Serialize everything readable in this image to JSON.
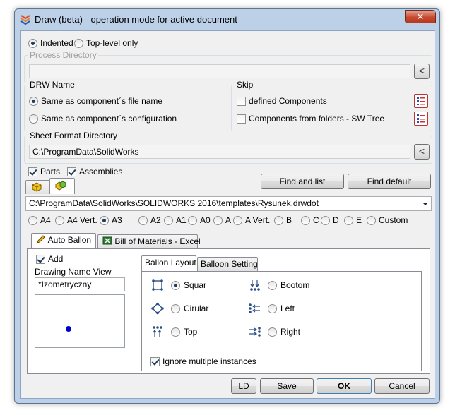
{
  "window": {
    "title": "Draw (beta) - operation mode for active document",
    "close_label": "✕"
  },
  "mode": {
    "indented": "Indented",
    "top_level": "Top-level only"
  },
  "process_directory": {
    "label": "Process Directory",
    "value": "",
    "browse": "<"
  },
  "drw_name": {
    "label": "DRW Name",
    "option_file": "Same as component´s file name",
    "option_config": "Same as component´s configuration"
  },
  "skip": {
    "label": "Skip",
    "defined": "defined Components",
    "folders": "Components from folders - SW Tree"
  },
  "sheet_format": {
    "label": "Sheet Format Directory",
    "value": "C:\\ProgramData\\SolidWorks",
    "browse": "<"
  },
  "filters": {
    "parts": "Parts",
    "assemblies": "Assemblies"
  },
  "buttons": {
    "find_and_list": "Find and list",
    "find_default": "Find default",
    "ld": "LD",
    "save": "Save",
    "ok": "OK",
    "cancel": "Cancel"
  },
  "template_path": "C:\\ProgramData\\SolidWorks\\SOLIDWORKS 2016\\templates\\Rysunek.drwdot",
  "sheet_sizes": [
    "A4",
    "A4 Vert.",
    "A3",
    "A2",
    "A1",
    "A0",
    "A",
    "A Vert.",
    "B",
    "C",
    "D",
    "E",
    "Custom"
  ],
  "selected_sheet_size": "A3",
  "tabs": {
    "auto_ballon": "Auto Ballon",
    "bom_excel": "Bill of Materials - Excel"
  },
  "auto_ballon": {
    "add": "Add",
    "drawing_name_view_label": "Drawing Name View",
    "drawing_name_view_value": "*Izometryczny",
    "inner_tabs": {
      "layout": "Ballon Layout",
      "setting": "Balloon Setting"
    },
    "layout_options": {
      "squar": "Squar",
      "cirular": "Cirular",
      "top": "Top",
      "bootom": "Bootom",
      "left": "Left",
      "right": "Right"
    },
    "ignore_multiple": "Ignore multiple instances"
  },
  "colors": {
    "accent": "#1f3b5c",
    "frame": "#bcd1e8",
    "preview_dot": "#0000cc"
  }
}
